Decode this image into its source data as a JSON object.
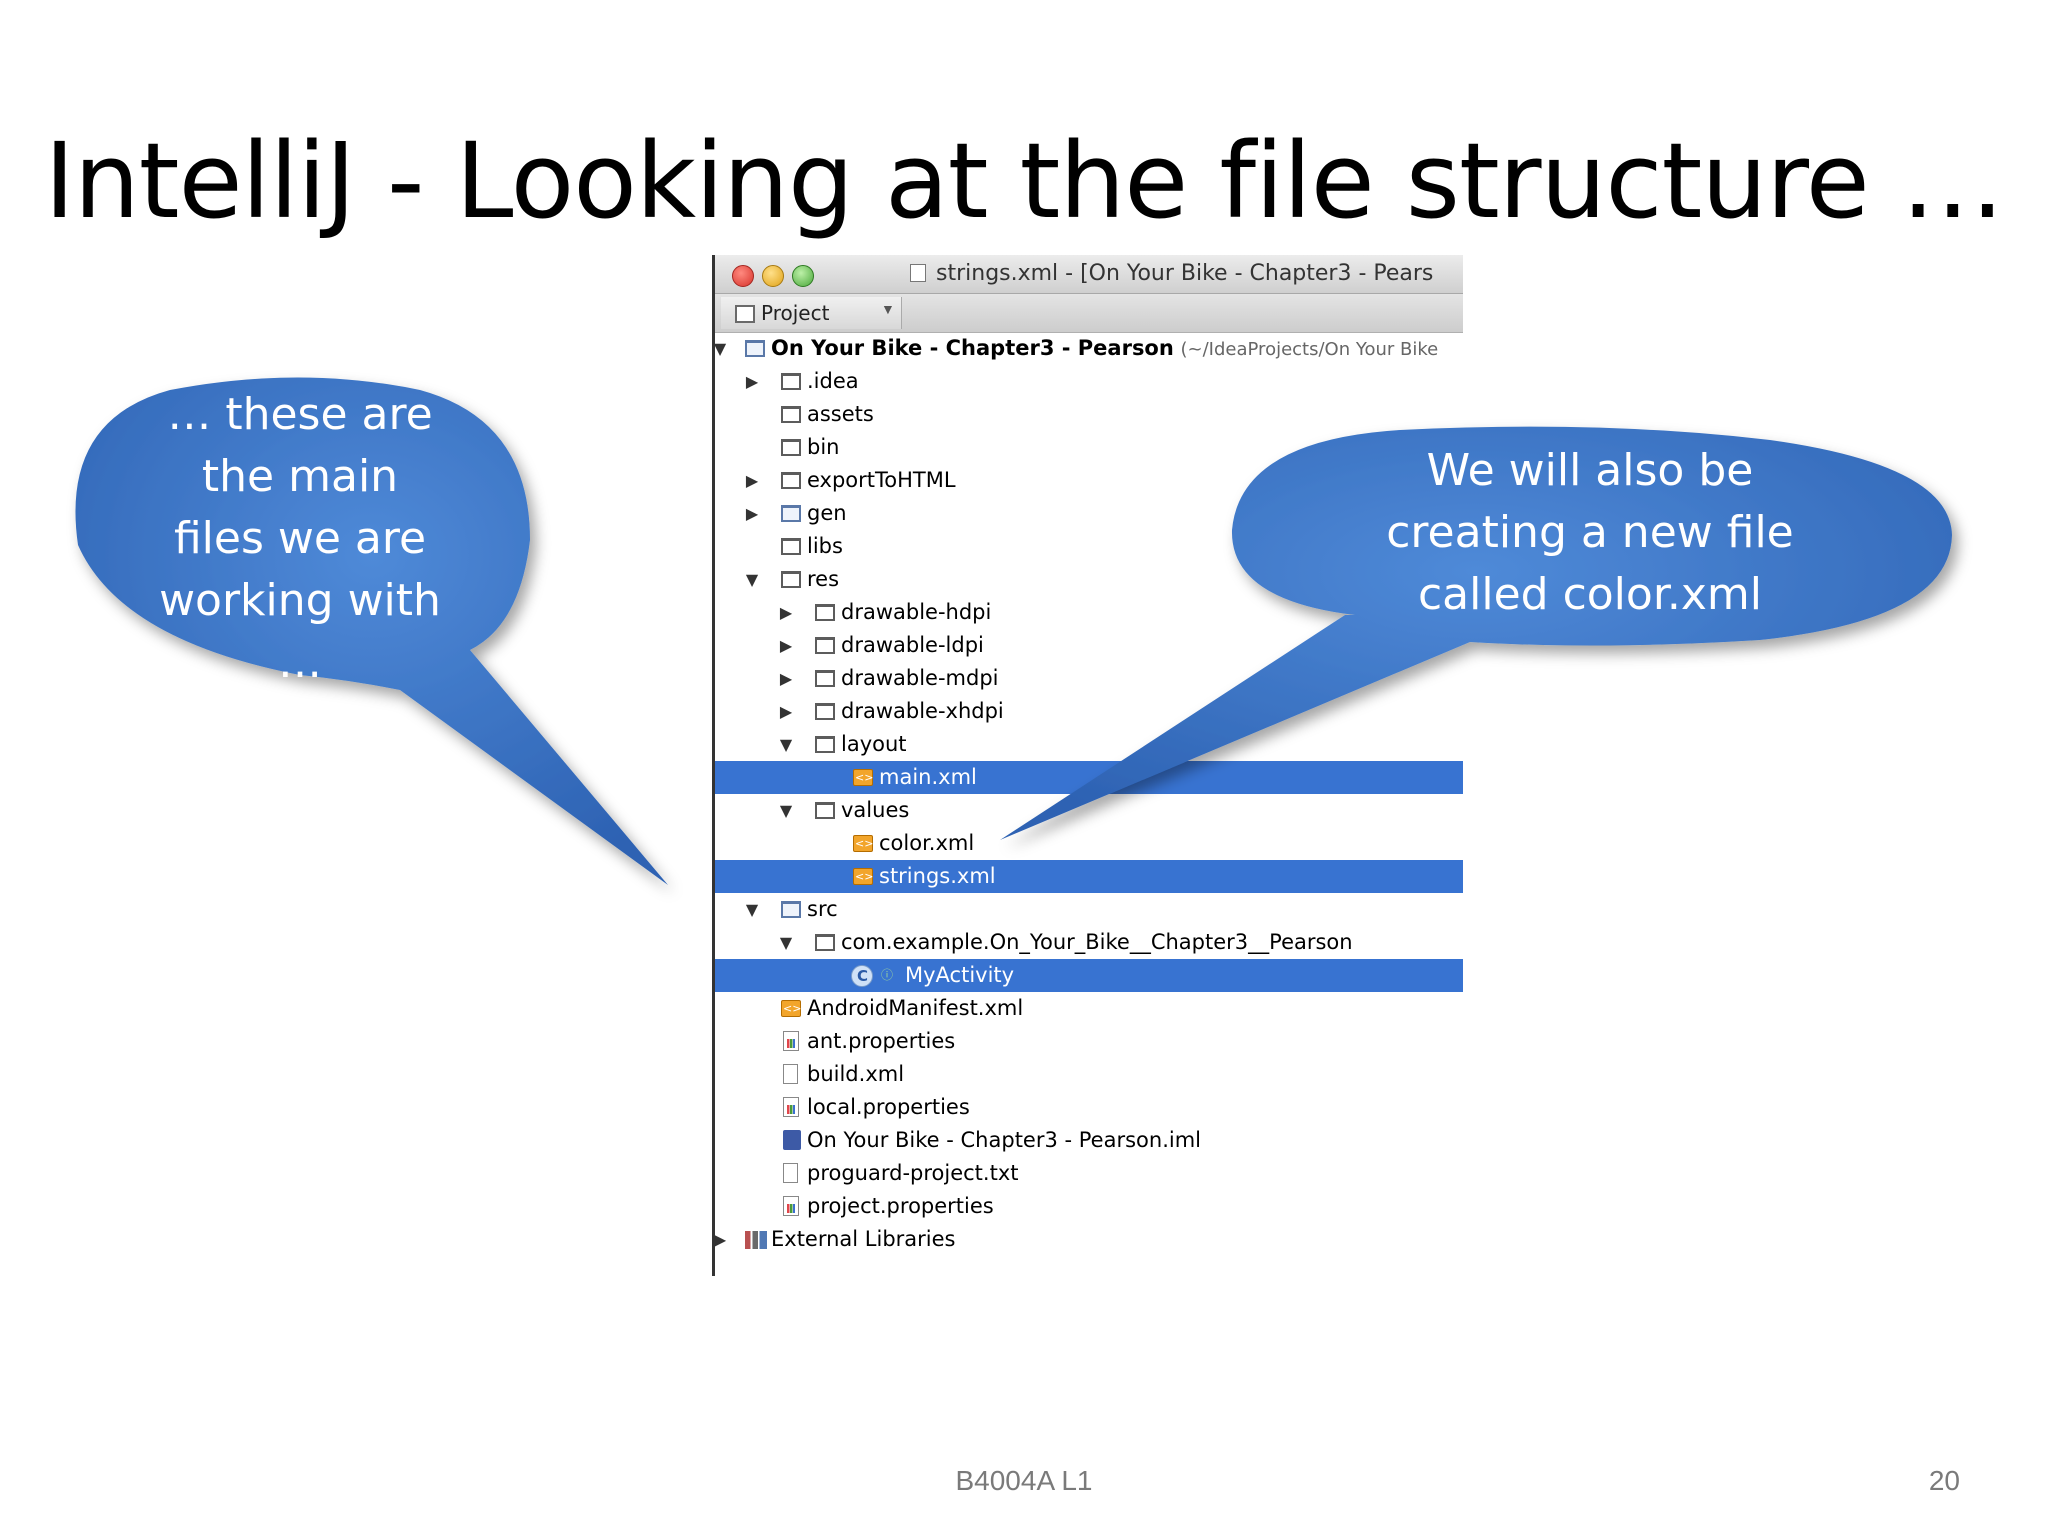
{
  "slide": {
    "title": "IntelliJ - Looking at the file structure …",
    "footer_center": "B4004A L1",
    "page_number": "20"
  },
  "window": {
    "title": "strings.xml - [On Your Bike - Chapter3 - Pears",
    "panel_label": "Project"
  },
  "tree": {
    "root_name": "On Your Bike - Chapter3 - Pearson",
    "root_path": "(~/IdeaProjects/On Your Bike",
    "idea": ".idea",
    "assets": "assets",
    "bin": "bin",
    "export": "exportToHTML",
    "gen": "gen",
    "libs": "libs",
    "res": "res",
    "drawable_hdpi": "drawable-hdpi",
    "drawable_ldpi": "drawable-ldpi",
    "drawable_mdpi": "drawable-mdpi",
    "drawable_xhdpi": "drawable-xhdpi",
    "layout": "layout",
    "main_xml": "main.xml",
    "values": "values",
    "color_xml": "color.xml",
    "strings_xml": "strings.xml",
    "src": "src",
    "package": "com.example.On_Your_Bike__Chapter3__Pearson",
    "my_activity": "MyActivity",
    "manifest": "AndroidManifest.xml",
    "ant_properties": "ant.properties",
    "build_xml": "build.xml",
    "local_properties": "local.properties",
    "iml": "On Your Bike - Chapter3 - Pearson.iml",
    "proguard": "proguard-project.txt",
    "project_properties": "project.properties",
    "external_libraries": "External Libraries"
  },
  "bubbles": {
    "left_line1": "… these are",
    "left_line2": "the main",
    "left_line3": "files we are",
    "left_line4": "working with",
    "left_line5": "…",
    "right_line1": "We will also be",
    "right_line2": "creating a new file",
    "right_line3": "called  color.xml"
  },
  "colors": {
    "selection": "#3873d1",
    "bubble": "#3a73c4"
  }
}
